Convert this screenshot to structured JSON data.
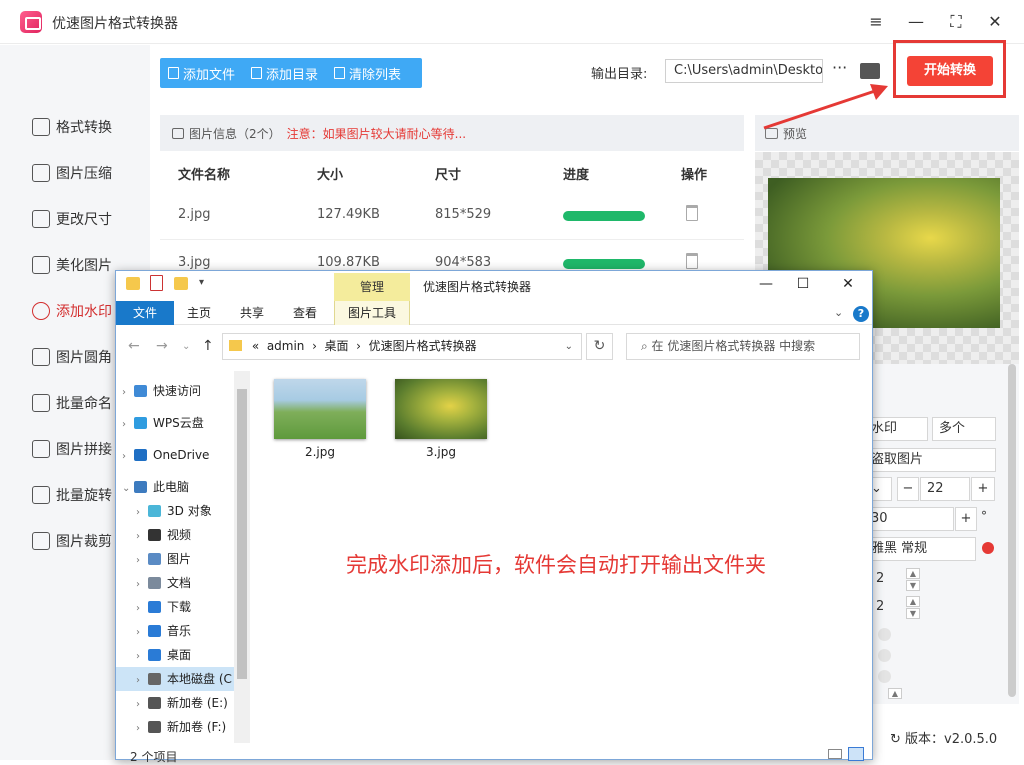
{
  "app": {
    "title": "优速图片格式转换器",
    "window": {
      "menu": "≡",
      "minimize": "—",
      "maximize": "⛶",
      "close": "✕"
    }
  },
  "sidebar": {
    "items": [
      {
        "label": "格式转换",
        "icon": "format-convert-icon"
      },
      {
        "label": "图片压缩",
        "icon": "compress-icon"
      },
      {
        "label": "更改尺寸",
        "icon": "resize-icon"
      },
      {
        "label": "美化图片",
        "icon": "beautify-icon"
      },
      {
        "label": "添加水印",
        "icon": "watermark-icon",
        "active": true
      },
      {
        "label": "图片圆角",
        "icon": "round-corner-icon"
      },
      {
        "label": "批量命名",
        "icon": "rename-icon"
      },
      {
        "label": "图片拼接",
        "icon": "stitch-icon"
      },
      {
        "label": "批量旋转",
        "icon": "rotate-icon"
      },
      {
        "label": "图片裁剪",
        "icon": "crop-icon"
      }
    ]
  },
  "toolbar": {
    "add_file": "添加文件",
    "add_dir": "添加目录",
    "clear_list": "清除列表",
    "output_label": "输出目录:",
    "output_path": "C:\\Users\\admin\\Deskto",
    "more": "···",
    "start": "开始转换"
  },
  "file_list": {
    "header": "图片信息（2个）",
    "warning": "注意：如果图片较大请耐心等待...",
    "columns": [
      "文件名称",
      "大小",
      "尺寸",
      "进度",
      "操作"
    ],
    "rows": [
      {
        "name": "2.jpg",
        "size": "127.49KB",
        "dims": "815*529",
        "progress": 1.0
      },
      {
        "name": "3.jpg",
        "size": "109.87KB",
        "dims": "904*583",
        "progress": 1.0
      }
    ]
  },
  "preview": {
    "title": "预览"
  },
  "settings": {
    "mode": "水印",
    "count": "多个",
    "text": "盗取图片",
    "size": "22",
    "angle": "30",
    "angle_unit": "°",
    "font": "雅黑 常规",
    "spacing_x": "2",
    "spacing_y": "2"
  },
  "version": "版本：v2.0.5.0",
  "explorer": {
    "manage_tab": "管理",
    "title": "优速图片格式转换器",
    "ribbon": [
      "文件",
      "主页",
      "共享",
      "查看",
      "图片工具"
    ],
    "address": [
      "«",
      "admin",
      "›",
      "桌面",
      "›",
      "优速图片格式转换器"
    ],
    "search_placeholder": "在 优速图片格式转换器 中搜索",
    "nav": [
      {
        "label": "快速访问",
        "chev": "›",
        "color": "#3f8ad6"
      },
      {
        "label": "WPS云盘",
        "chev": "›",
        "color": "#2f9ce0"
      },
      {
        "label": "OneDrive",
        "chev": "›",
        "color": "#1f6fc4"
      },
      {
        "label": "此电脑",
        "chev": "⌄",
        "color": "#3d7bbf"
      },
      {
        "label": "3D 对象",
        "chev": "›",
        "color": "#4bb6d8"
      },
      {
        "label": "视频",
        "chev": "›",
        "color": "#333333"
      },
      {
        "label": "图片",
        "chev": "›",
        "color": "#5a8bc4"
      },
      {
        "label": "文档",
        "chev": "›",
        "color": "#7b8a9c"
      },
      {
        "label": "下载",
        "chev": "›",
        "color": "#2a7bd6"
      },
      {
        "label": "音乐",
        "chev": "›",
        "color": "#2a7bd6"
      },
      {
        "label": "桌面",
        "chev": "›",
        "color": "#2a7bd6"
      },
      {
        "label": "本地磁盘 (C",
        "chev": "›",
        "color": "#666666",
        "selected": true
      },
      {
        "label": "新加卷 (E:)",
        "chev": "›",
        "color": "#555555"
      },
      {
        "label": "新加卷 (F:)",
        "chev": "›",
        "color": "#555555"
      }
    ],
    "files": [
      {
        "name": "2.jpg"
      },
      {
        "name": "3.jpg"
      }
    ],
    "message": "完成水印添加后，软件会自动打开输出文件夹",
    "status": "2 个项目"
  }
}
